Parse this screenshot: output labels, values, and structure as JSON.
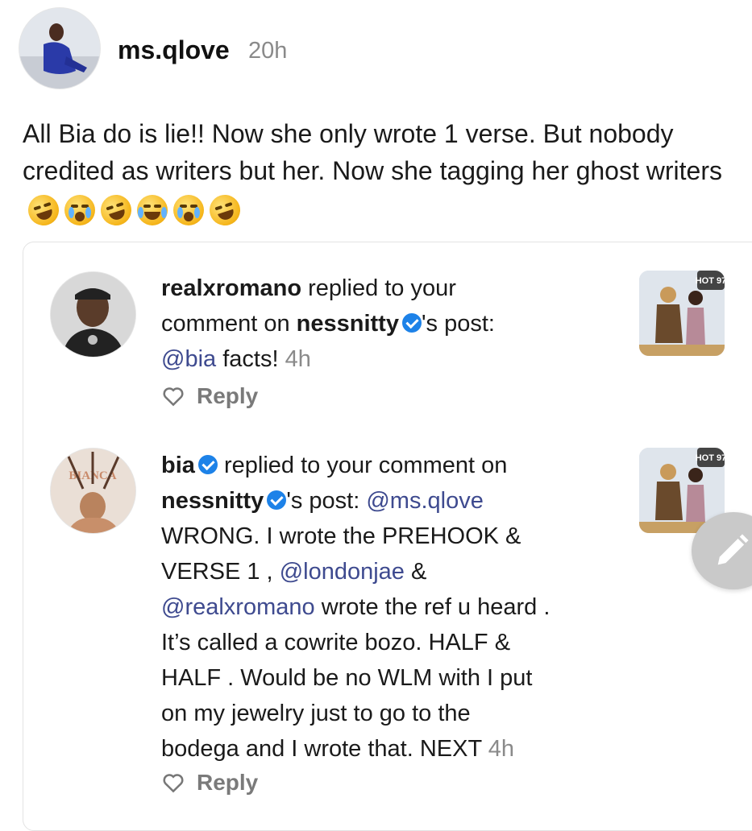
{
  "post": {
    "username": "ms.qlove",
    "time": "20h",
    "text": "All Bia do is lie!! Now she only wrote 1 verse. But nobody credited as writers but her. Now she tagging her ghost writers",
    "emojis": [
      "rolling-on-floor-laughing",
      "loudly-crying",
      "rolling-on-floor-laughing",
      "tears-of-joy",
      "loudly-crying",
      "rolling-on-floor-laughing"
    ]
  },
  "replies": [
    {
      "username": "realxromano",
      "action": "replied to your",
      "action_line2": "comment on",
      "post_owner": "nessnitty",
      "post_suffix": "'s post:",
      "mention": "@bia",
      "body": " facts!",
      "time": "4h",
      "reply_label": "Reply"
    },
    {
      "username": "bia",
      "action": "replied to your comment on",
      "post_owner": "nessnitty",
      "post_suffix": "'s post:",
      "mention1": "@ms.qlove",
      "body1": "WRONG. I wrote the PREHOOK &",
      "body2": "VERSE 1 ,",
      "mention2": "@londonjae",
      "body3": "&",
      "mention3": "@realxromano",
      "body4": "wrote the ref u heard .",
      "body5": "It’s called a cowrite bozo. HALF &",
      "body6": "HALF . Would be no WLM with I put",
      "body7": "on my jewelry just to go to the",
      "body8": "bodega and I wrote that. NEXT",
      "time": "4h",
      "reply_label": "Reply"
    }
  ],
  "thumb_logo": "HOT 97",
  "avatar_lettering": "BIANCA"
}
